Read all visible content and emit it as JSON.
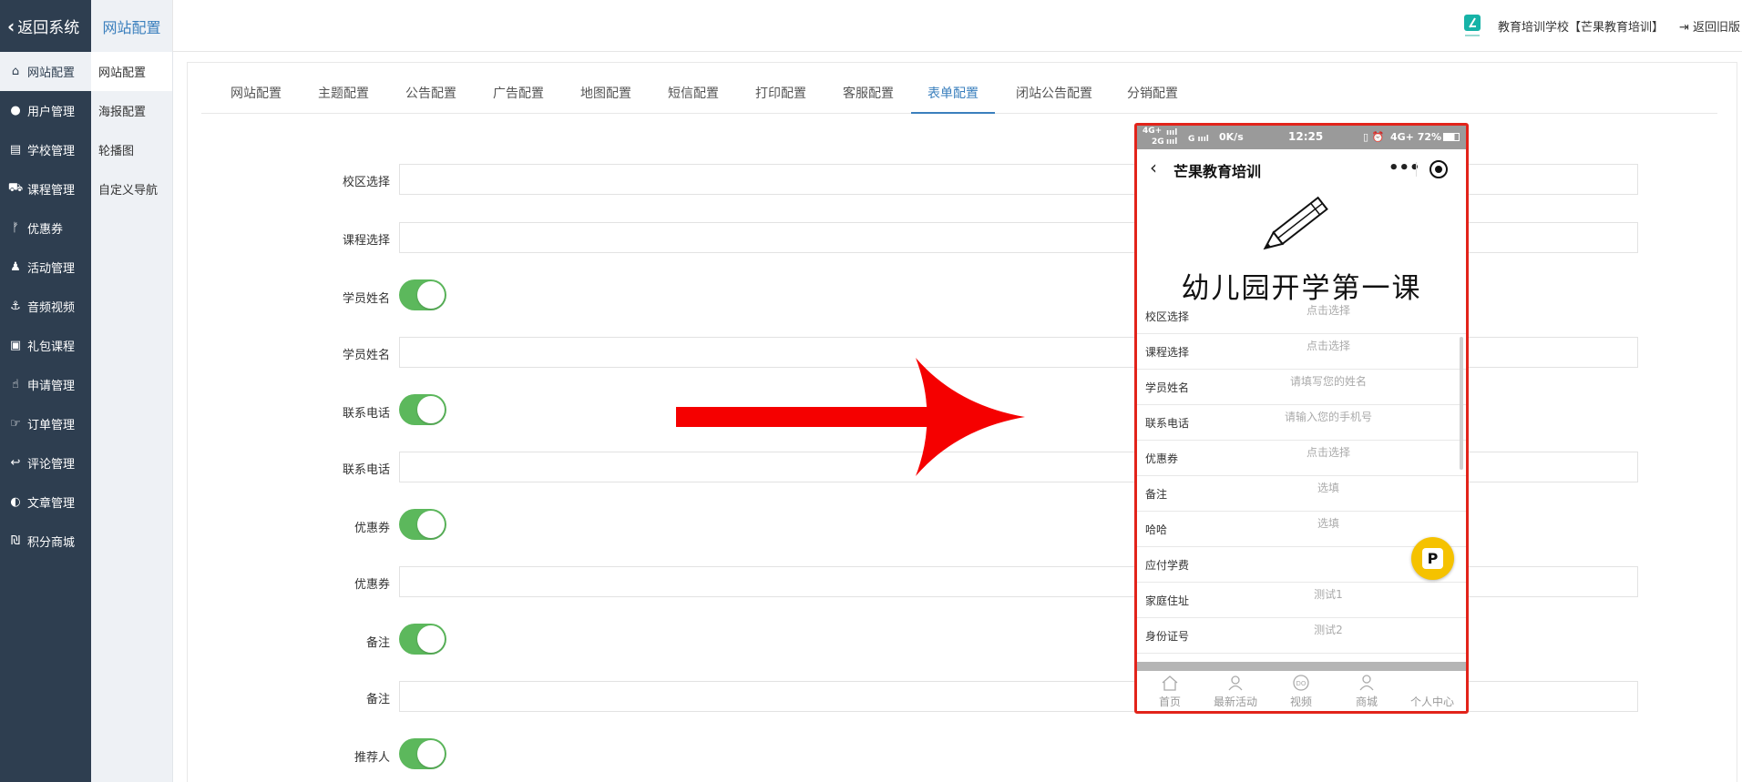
{
  "topbar": {
    "back_label": "返回系统",
    "title": "网站配置",
    "school": "教育培训学校【芒果教育培训】",
    "old_version": "返回旧版"
  },
  "leftnav": [
    {
      "label": "网站配置",
      "icon": "home-icon"
    },
    {
      "label": "用户管理",
      "icon": "user-icon"
    },
    {
      "label": "学校管理",
      "icon": "school-icon"
    },
    {
      "label": "课程管理",
      "icon": "cart-icon"
    },
    {
      "label": "优惠券",
      "icon": "coupon-icon"
    },
    {
      "label": "活动管理",
      "icon": "activity-icon"
    },
    {
      "label": "音频视频",
      "icon": "anchor-icon"
    },
    {
      "label": "礼包课程",
      "icon": "gift-icon"
    },
    {
      "label": "申请管理",
      "icon": "hand-icon"
    },
    {
      "label": "订单管理",
      "icon": "thumbs-up-icon"
    },
    {
      "label": "评论管理",
      "icon": "reply-icon"
    },
    {
      "label": "文章管理",
      "icon": "contrast-icon"
    },
    {
      "label": "积分商城",
      "icon": "mall-icon"
    }
  ],
  "subnav": [
    "网站配置",
    "海报配置",
    "轮播图",
    "自定义导航"
  ],
  "tabs": [
    "网站配置",
    "主题配置",
    "公告配置",
    "广告配置",
    "地图配置",
    "短信配置",
    "打印配置",
    "客服配置",
    "表单配置",
    "闭站公告配置",
    "分销配置"
  ],
  "active_tab": "表单配置",
  "form": {
    "campus": "校区选择",
    "course": "课程选择",
    "student_toggle": "学员姓名",
    "student": "学员姓名",
    "phone_toggle": "联系电话",
    "phone": "联系电话",
    "coupon_toggle": "优惠券",
    "coupon": "优惠券",
    "remark_toggle": "备注",
    "remark": "备注",
    "referrer_toggle": "推荐人"
  },
  "phone": {
    "status_left_top": "4G+",
    "status_left_bottom": "2G",
    "status_speed": "0K/s",
    "status_time": "12:25",
    "status_right": "4G+ 72%",
    "title": "芒果教育培训",
    "banner_text": "幼儿园开学第一课",
    "rows": [
      {
        "label": "校区选择",
        "placeholder": "点击选择"
      },
      {
        "label": "课程选择",
        "placeholder": "点击选择"
      },
      {
        "label": "学员姓名",
        "placeholder": "请填写您的姓名"
      },
      {
        "label": "联系电话",
        "placeholder": "请输入您的手机号"
      },
      {
        "label": "优惠券",
        "placeholder": "点击选择"
      },
      {
        "label": "备注",
        "placeholder": "选填"
      },
      {
        "label": "哈哈",
        "placeholder": "选填"
      },
      {
        "label": "应付学费",
        "placeholder": ""
      },
      {
        "label": "家庭住址",
        "placeholder": "测试1"
      },
      {
        "label": "身份证号",
        "placeholder": "测试2"
      }
    ],
    "fab": "P",
    "tabbar": [
      "首页",
      "最新活动",
      "视频",
      "商城",
      "个人中心"
    ]
  },
  "colors": {
    "sidebar": "#2e3e50",
    "accent": "#3a7fbd",
    "toggle_on": "#5cb85c",
    "highlight": "#e2231a"
  }
}
